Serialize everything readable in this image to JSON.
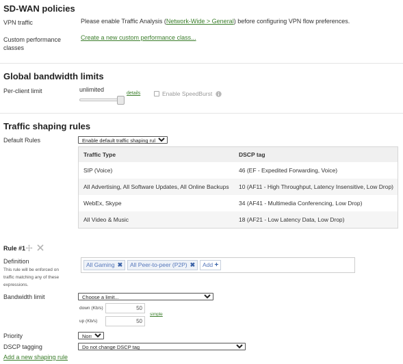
{
  "sdwan": {
    "title": "SD-WAN policies",
    "vpn_label": "VPN traffic",
    "vpn_text_before": "Please enable Traffic Analysis (",
    "vpn_link": "Network-Wide > General",
    "vpn_text_after": ") before configuring VPN flow preferences.",
    "custom_label_line1": "Custom performance",
    "custom_label_line2": "classes",
    "custom_link": "Create a new custom performance class..."
  },
  "bandwidth": {
    "title": "Global bandwidth limits",
    "per_client_label": "Per-client limit",
    "value": "unlimited",
    "details_link": "details",
    "speedburst_label": "Enable SpeedBurst",
    "slider_level_percent": 100
  },
  "shaping": {
    "title": "Traffic shaping rules",
    "default_rules_label": "Default Rules",
    "default_rules_selected": "Enable default traffic shaping rules",
    "columns": [
      "Traffic Type",
      "DSCP tag"
    ],
    "rows": [
      {
        "type": "SIP (Voice)",
        "dscp": "46 (EF - Expedited Forwarding, Voice)"
      },
      {
        "type": "All Advertising, All Software Updates, All Online Backups",
        "dscp": "10 (AF11 - High Throughput, Latency Insensitive, Low Drop)"
      },
      {
        "type": "WebEx, Skype",
        "dscp": "34 (AF41 - Multimedia Conferencing, Low Drop)"
      },
      {
        "type": "All Video & Music",
        "dscp": "18 (AF21 - Low Latency Data, Low Drop)"
      }
    ]
  },
  "rule": {
    "title": "Rule #1",
    "definition_label": "Definition",
    "definition_help_line1": "This rule will be enforced on",
    "definition_help_line2": "traffic matching any of these",
    "definition_help_line3": "expressions.",
    "tags": [
      "All Gaming",
      "All Peer-to-peer (P2P)"
    ],
    "add_label": "Add",
    "bandwidth_label": "Bandwidth limit",
    "bandwidth_selected": "Choose a limit...",
    "down_label": "down (Kb/s)",
    "down_value": "50",
    "up_label": "up (Kb/s)",
    "up_value": "50",
    "simple_link": "simple",
    "priority_label": "Priority",
    "priority_selected": "Normal",
    "dscp_label": "DSCP tagging",
    "dscp_selected": "Do not change DSCP tag",
    "add_rule_link": "Add a new shaping rule"
  }
}
